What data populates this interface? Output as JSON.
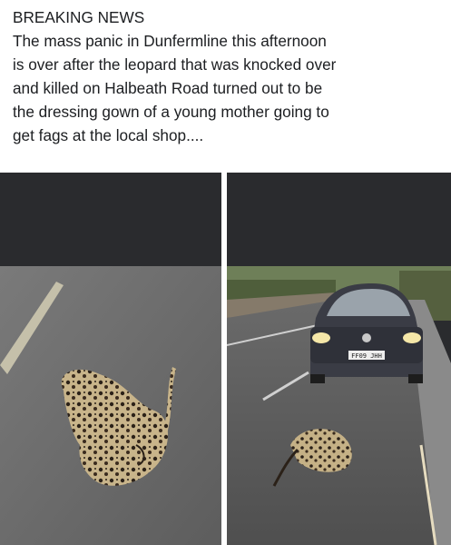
{
  "post": {
    "lines": [
      "BREAKING NEWS",
      "The mass panic in Dunfermline this afternoon",
      "is over after the leopard that was knocked over",
      "and killed on Halbeath Road turned out to be",
      "the dressing gown of a young mother going to",
      "get fags at the local shop...."
    ]
  },
  "photos": [
    {
      "subject": "leopard-print-dressing-gown-on-road"
    },
    {
      "subject": "car-approaching-dressing-gown-on-road",
      "plate": "FF09 JHH"
    }
  ],
  "colors": {
    "text": "#1c1e21",
    "dark_band": "#2a2b2e",
    "asphalt": "#6f6f6f",
    "car": "#3a3c45"
  }
}
